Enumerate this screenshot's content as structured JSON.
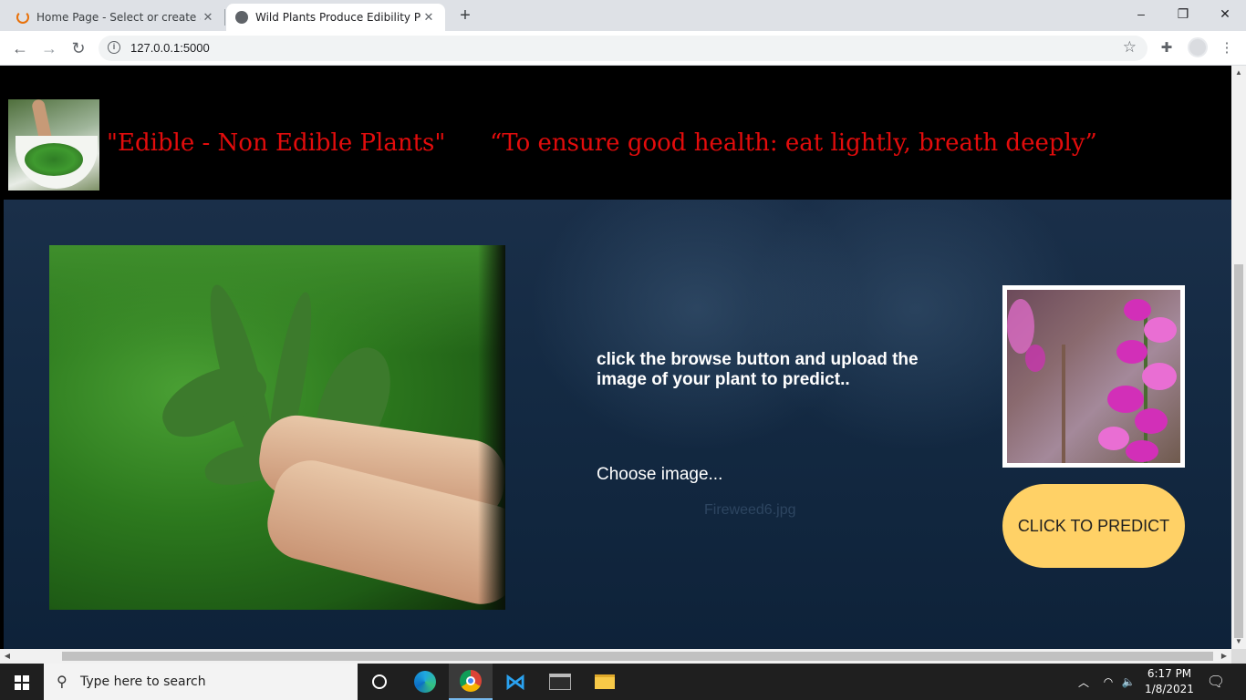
{
  "browser": {
    "tabs": [
      {
        "title": "Home Page - Select or create a n",
        "active": false
      },
      {
        "title": "Wild Plants Produce Edibility Pre",
        "active": true
      }
    ],
    "url": "127.0.0.1:5000"
  },
  "page": {
    "title": "\"Edible - Non Edible Plants\"",
    "quote": "“To ensure good health: eat lightly, breath deeply”",
    "instruction": "click the browse button and upload the image of your plant to predict..",
    "choose_label": "Choose image...",
    "file_name": "Fireweed6.jpg",
    "predict_button": "CLICK TO PREDICT"
  },
  "taskbar": {
    "search_placeholder": "Type here to search",
    "time": "6:17 PM",
    "date": "1/8/2021"
  },
  "colors": {
    "title_red": "#e20c0c",
    "predict_button_bg": "#ffd166",
    "main_bg": "#142a43"
  }
}
